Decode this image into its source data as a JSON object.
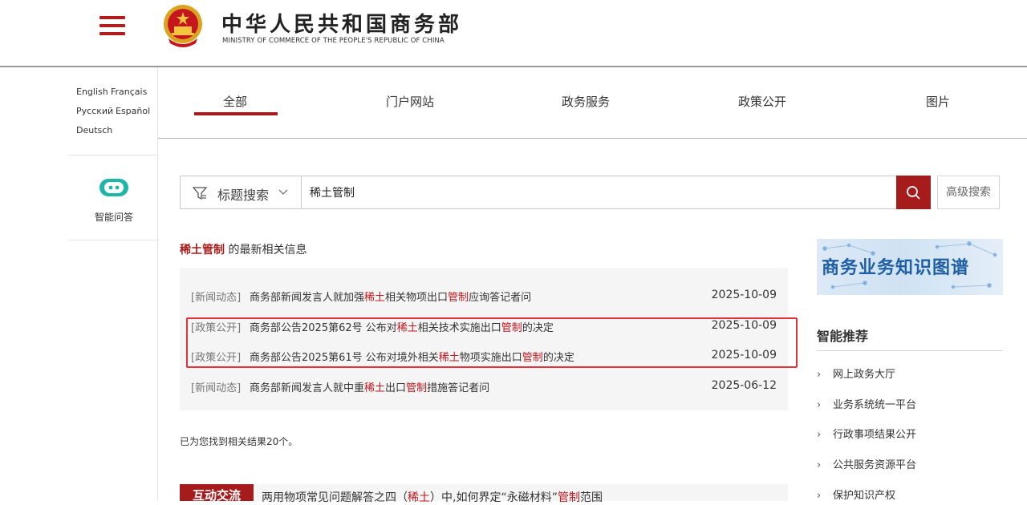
{
  "header": {
    "title": "中华人民共和国商务部",
    "subtitle": "MINISTRY OF COMMERCE OF THE PEOPLE'S REPUBLIC OF CHINA"
  },
  "languages": [
    "English",
    "Français",
    "Русский",
    "Español",
    "Deutsch"
  ],
  "assistant": {
    "label": "智能问答",
    "icon": "chat-bot-icon"
  },
  "tabs": [
    {
      "label": "全部",
      "active": true
    },
    {
      "label": "门户网站"
    },
    {
      "label": "政务服务"
    },
    {
      "label": "政策公开"
    },
    {
      "label": "图片"
    }
  ],
  "search": {
    "type_label": "标题搜索",
    "query": "稀土管制",
    "advanced_label": "高级搜索"
  },
  "results_heading": {
    "keyword": "稀土管制",
    "suffix": " 的最新相关信息"
  },
  "results": [
    {
      "category": "[新闻动态]",
      "title_parts": [
        {
          "t": "商务部新闻发言人就加强"
        },
        {
          "t": "稀土",
          "hl": true
        },
        {
          "t": "相关物项出口"
        },
        {
          "t": "管制",
          "hl": true
        },
        {
          "t": "应询答记者问"
        }
      ],
      "date": "2025-10-09"
    },
    {
      "category": "[政策公开]",
      "title_parts": [
        {
          "t": "商务部公告2025第62号 公布对"
        },
        {
          "t": "稀土",
          "hl": true
        },
        {
          "t": "相关技术实施出口"
        },
        {
          "t": "管制",
          "hl": true
        },
        {
          "t": "的决定"
        }
      ],
      "date": "2025-10-09"
    },
    {
      "category": "[政策公开]",
      "title_parts": [
        {
          "t": "商务部公告2025第61号 公布对境外相关"
        },
        {
          "t": "稀土",
          "hl": true
        },
        {
          "t": "物项实施出口"
        },
        {
          "t": "管制",
          "hl": true
        },
        {
          "t": "的决定"
        }
      ],
      "date": "2025-10-09"
    },
    {
      "category": "[新闻动态]",
      "title_parts": [
        {
          "t": "商务部新闻发言人就中重"
        },
        {
          "t": "稀土",
          "hl": true
        },
        {
          "t": "出口"
        },
        {
          "t": "管制",
          "hl": true
        },
        {
          "t": "措施答记者问"
        }
      ],
      "date": "2025-06-12"
    }
  ],
  "found_text": "已为您找到相关结果20个。",
  "bottom_item": {
    "badge": "互动交流",
    "title_parts": [
      {
        "t": "两用物项常见问题解答之四（"
      },
      {
        "t": "稀土",
        "hl": true
      },
      {
        "t": "）中,如何界定“永磁材料”"
      },
      {
        "t": "管制",
        "hl": true
      },
      {
        "t": "范围"
      }
    ]
  },
  "right": {
    "banner_text": "商务业务知识图谱",
    "recommend_title": "智能推荐",
    "recommend_items": [
      "网上政务大厅",
      "业务系统统一平台",
      "行政事项结果公开",
      "公共服务资源平台",
      "保护知识产权"
    ]
  },
  "colors": {
    "brand": "#a61b1b",
    "highlight_text": "#c4161c",
    "annotation_box": "#e0343a"
  }
}
